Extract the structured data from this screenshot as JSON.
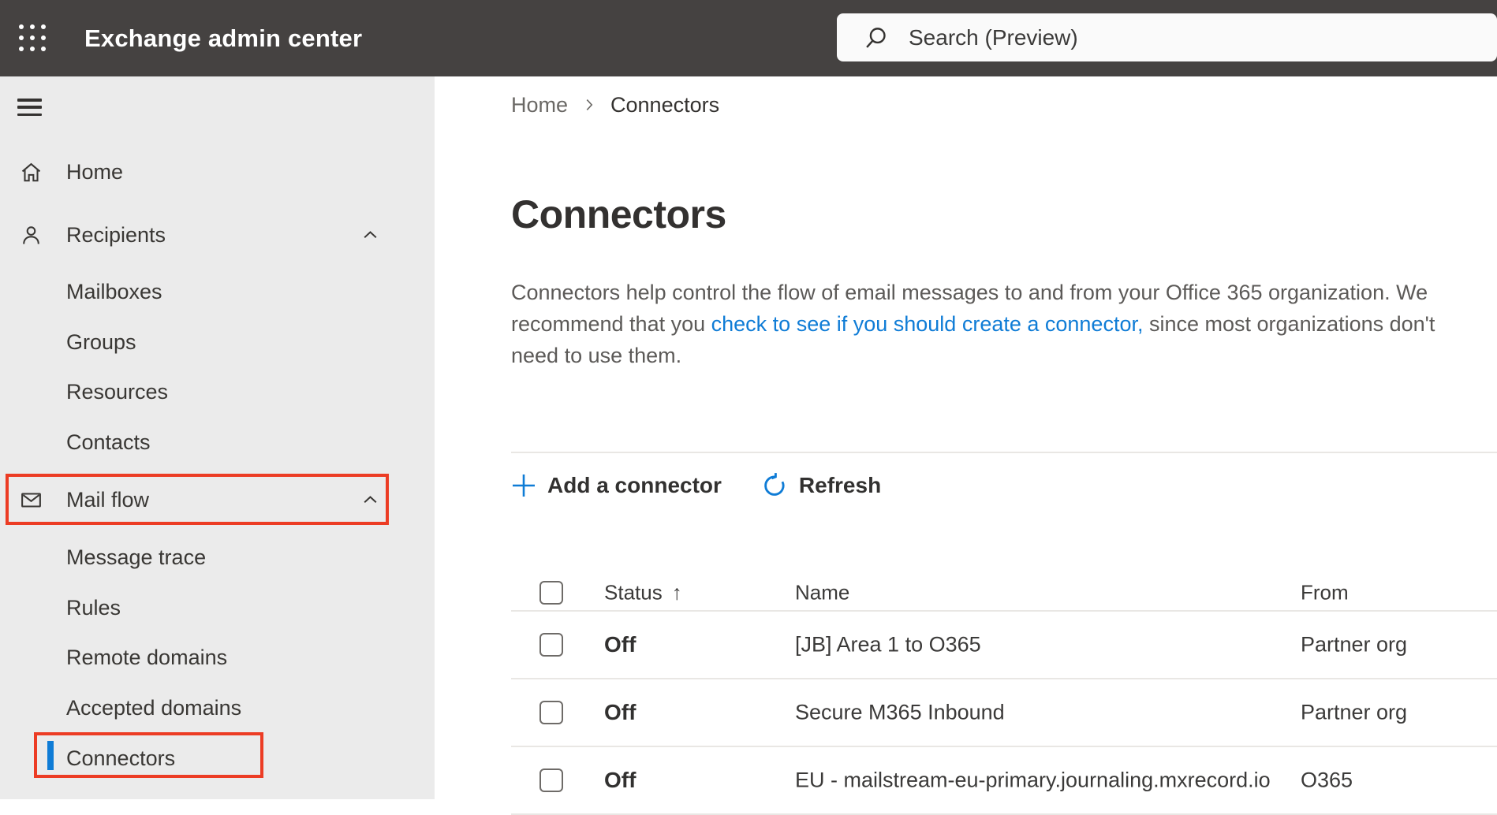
{
  "topbar": {
    "app_title": "Exchange admin center",
    "search_placeholder": "Search (Preview)"
  },
  "sidebar": {
    "items": {
      "home": "Home",
      "recipients": "Recipients",
      "mailboxes": "Mailboxes",
      "groups": "Groups",
      "resources": "Resources",
      "contacts": "Contacts",
      "mail_flow": "Mail flow",
      "message_trace": "Message trace",
      "rules": "Rules",
      "remote_domains": "Remote domains",
      "accepted_domains": "Accepted domains",
      "connectors": "Connectors"
    }
  },
  "breadcrumb": {
    "home": "Home",
    "current": "Connectors"
  },
  "page": {
    "title": "Connectors"
  },
  "description": {
    "line1": "Connectors help control the flow of email messages to and from your Office 365 organization. We",
    "line2_pre": "recommend that you ",
    "link": "check to see if you should create a connector,",
    "line2_post": " since most organizations don't",
    "line3": "need to use them."
  },
  "toolbar": {
    "add": "Add a connector",
    "refresh": "Refresh"
  },
  "table": {
    "headers": {
      "status": "Status",
      "name": "Name",
      "from": "From"
    },
    "sort_indicator": "↑",
    "rows": [
      {
        "status": "Off",
        "name": "[JB] Area 1 to O365",
        "from": "Partner org"
      },
      {
        "status": "Off",
        "name": "Secure M365 Inbound",
        "from": "Partner org"
      },
      {
        "status": "Off",
        "name": "EU - mailstream-eu-primary.journaling.mxrecord.io",
        "from": "O365"
      }
    ]
  },
  "colors": {
    "topbar_bg": "#454241",
    "sidebar_bg": "#ebebeb",
    "accent_blue": "#0f7cd6",
    "annotation_red": "#ec3c24",
    "divider_gray": "#e9e7e4"
  }
}
